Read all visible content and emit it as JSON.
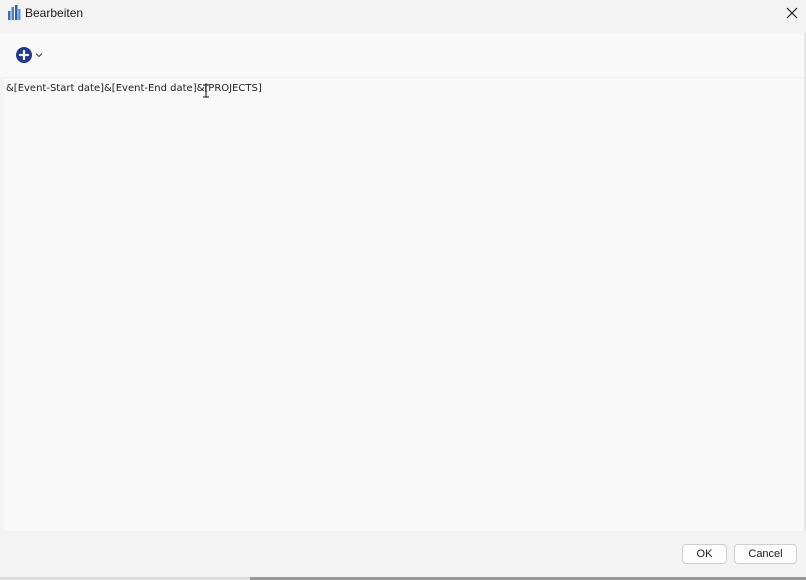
{
  "window": {
    "title": "Bearbeiten"
  },
  "toolbar": {
    "add_icon": "plus-circle-icon",
    "dropdown_icon": "chevron-down-icon"
  },
  "editor": {
    "content": "&[Event-Start date]&[Event-End date]&[PROJECTS]"
  },
  "footer": {
    "ok_label": "OK",
    "cancel_label": "Cancel"
  },
  "colors": {
    "accent": "#1f3a8a",
    "window_bg": "#f3f3f3",
    "editor_bg": "#f9f9f9"
  }
}
